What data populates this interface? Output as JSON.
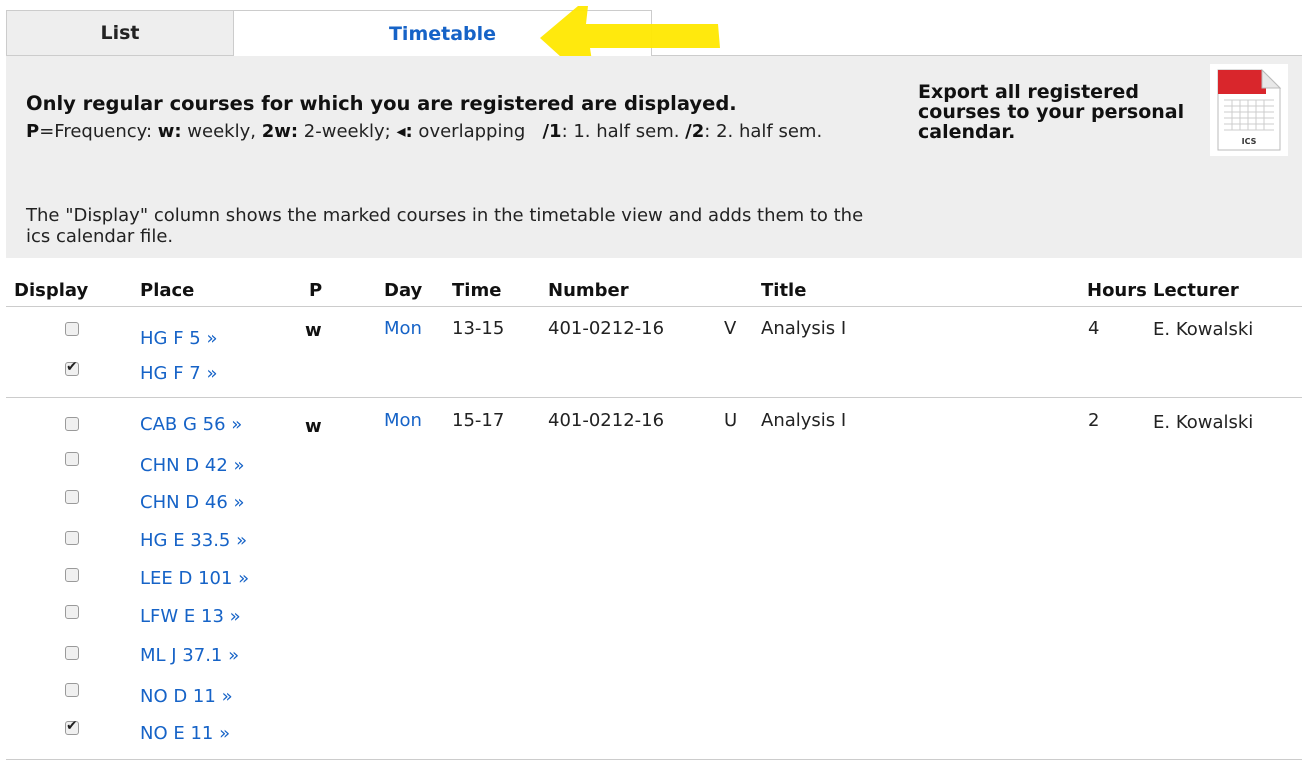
{
  "tabs": {
    "list": "List",
    "timetable": "Timetable"
  },
  "info": {
    "title": "Only regular courses for which you are registered are displayed.",
    "freq_p": "P",
    "freq_label": "=Frequency: ",
    "freq_w": "w:",
    "freq_w_text": " weekly, ",
    "freq_2w": "2w:",
    "freq_2w_text": " 2-weekly; ",
    "freq_overlap_sym": "◂:",
    "freq_overlap_text": " overlapping   ",
    "half1": "/1",
    "half1_text": ": 1. half sem. ",
    "half2": "/2",
    "half2_text": ": 2. half sem.",
    "display_note": "The \"Display\" column shows the marked courses in the timetable view and adds them to the ics calendar file.",
    "export": "Export all registered courses to your personal calendar.",
    "ics_label": "ICS"
  },
  "columns": {
    "display": "Display",
    "place": "Place",
    "p": "P",
    "day": "Day",
    "time": "Time",
    "number": "Number",
    "title": "Title",
    "hours": "Hours",
    "lecturer": "Lecturer"
  },
  "courses": [
    {
      "places": [
        {
          "name": "HG F 5 »",
          "checked": false
        },
        {
          "name": "HG F 7 »",
          "checked": true
        }
      ],
      "p": "w",
      "day": "Mon",
      "time": "13-15",
      "number": "401-0212-16",
      "type": "V",
      "title": "Analysis I",
      "hours": "4",
      "lecturer": "E. Kowalski"
    },
    {
      "places": [
        {
          "name": "CAB G 56 »",
          "checked": false
        },
        {
          "name": "CHN D 42 »",
          "checked": false
        },
        {
          "name": "CHN D 46 »",
          "checked": false
        },
        {
          "name": "HG E 33.5 »",
          "checked": false
        },
        {
          "name": "LEE D 101 »",
          "checked": false
        },
        {
          "name": "LFW E 13 »",
          "checked": false
        },
        {
          "name": "ML J 37.1 »",
          "checked": false
        },
        {
          "name": "NO D 11 »",
          "checked": false
        },
        {
          "name": "NO E 11 »",
          "checked": true
        }
      ],
      "p": "w",
      "day": "Mon",
      "time": "15-17",
      "number": "401-0212-16",
      "type": "U",
      "title": "Analysis I",
      "hours": "2",
      "lecturer": "E. Kowalski"
    }
  ],
  "colors": {
    "link": "#1663c7",
    "panel": "#eeeeee",
    "highlight": "#ffe800"
  }
}
